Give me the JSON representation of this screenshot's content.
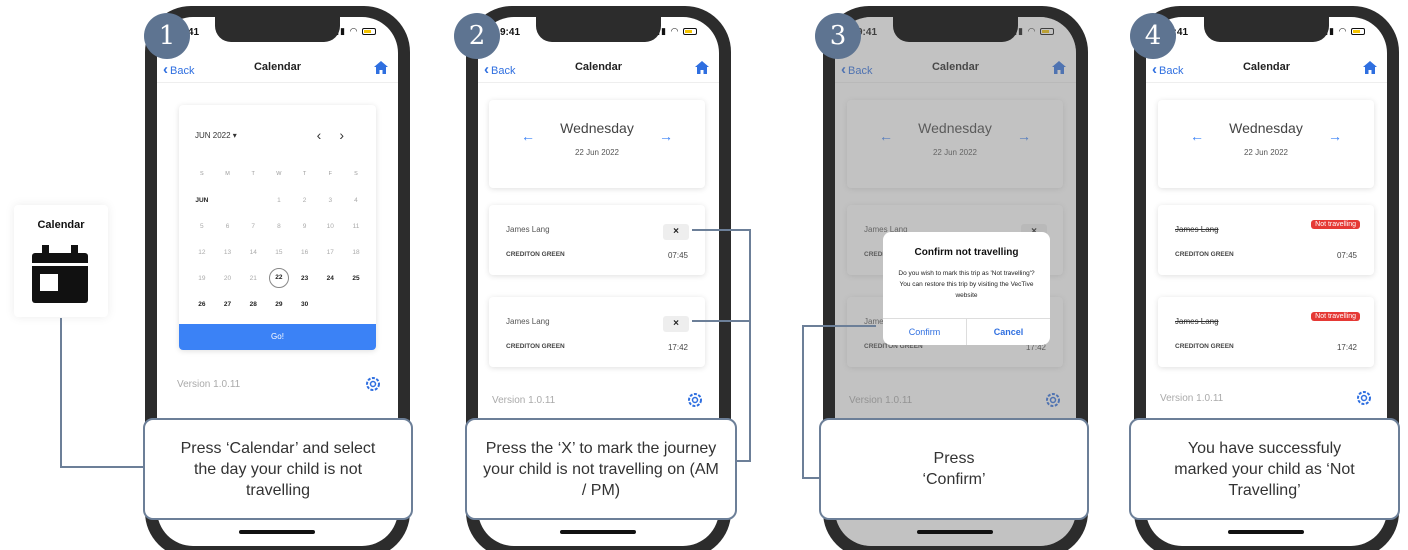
{
  "steps": [
    "1",
    "2",
    "3",
    "4"
  ],
  "status": {
    "time_1": "9:41",
    "time_2": "9:41",
    "time_3": "9:41",
    "time_4": "9:41"
  },
  "nav": {
    "back": "Back",
    "title": "Calendar"
  },
  "tile": {
    "label": "Calendar"
  },
  "calendar": {
    "month": "JUN 2022 ▾",
    "prev": "‹",
    "next": "›",
    "weekdays": [
      "S",
      "M",
      "T",
      "W",
      "T",
      "F",
      "S"
    ],
    "rows": [
      [
        "JUN",
        "",
        "",
        "1",
        "2",
        "3",
        "4"
      ],
      [
        "5",
        "6",
        "7",
        "8",
        "9",
        "10",
        "11"
      ],
      [
        "12",
        "13",
        "14",
        "15",
        "16",
        "17",
        "18"
      ],
      [
        "19",
        "20",
        "21",
        "22",
        "23",
        "24",
        "25"
      ],
      [
        "26",
        "27",
        "28",
        "29",
        "30",
        "",
        ""
      ]
    ],
    "selected": "22",
    "go": "Go!"
  },
  "version": "Version 1.0.11",
  "day": {
    "name": "Wednesday",
    "date": "22 Jun 2022",
    "prev_arrow": "←",
    "next_arrow": "→"
  },
  "trips": [
    {
      "name": "James Lang",
      "stop": "CREDITON GREEN",
      "time": "07:45"
    },
    {
      "name": "James Lang",
      "stop": "CREDITON GREEN",
      "time": "17:42"
    }
  ],
  "x_label": "×",
  "dialog": {
    "title": "Confirm not travelling",
    "body": "Do you wish to mark this trip as 'Not travelling'? You can restore this trip by visiting the VecTive website",
    "confirm": "Confirm",
    "cancel": "Cancel"
  },
  "badge": "Not travelling",
  "callouts": {
    "c1": "Press ‘Calendar’ and select the day your child is not travelling",
    "c2": "Press the ‘X’ to mark the journey your child is not travelling on (AM / PM)",
    "c3": "Press ‘Confirm’",
    "c4": "You have successfuly marked your child as ‘Not Travelling’"
  },
  "colors": {
    "accent": "#3b82f6",
    "step_badge": "#5e7491",
    "badge_red": "#e53935"
  }
}
